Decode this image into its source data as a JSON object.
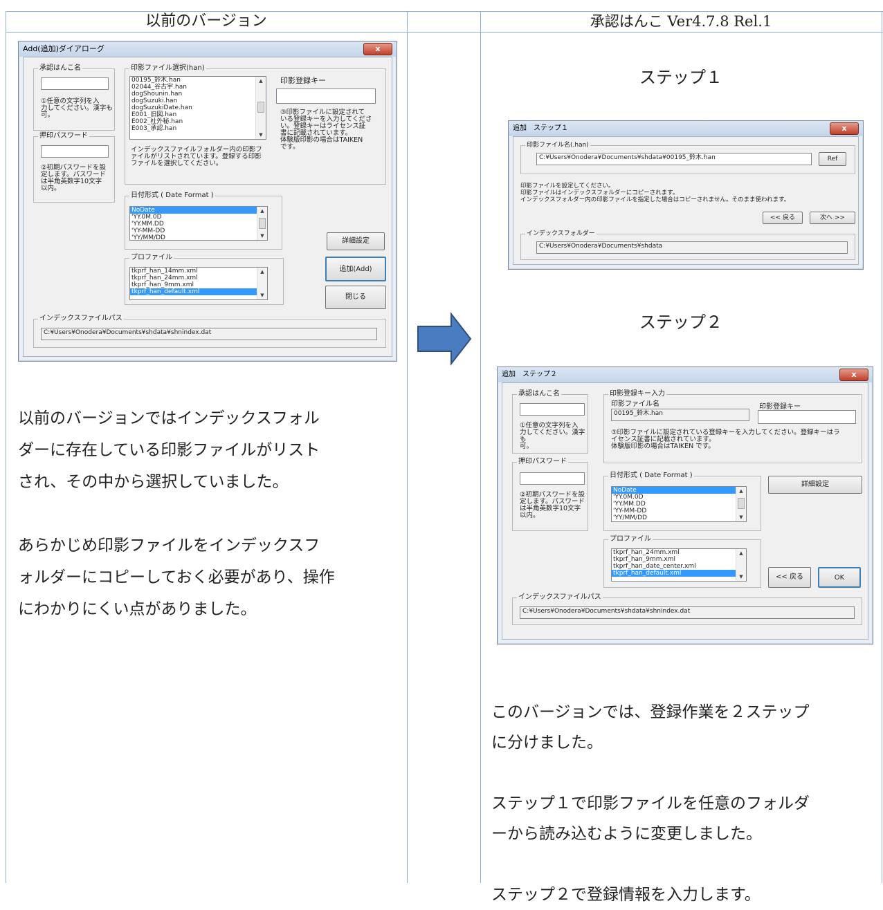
{
  "headers": {
    "left": "以前のバージョン",
    "right": "承認はんこ Ver4.7.8 Rel.1"
  },
  "old_dialog": {
    "title": "Add(追加)ダイアローグ",
    "close": "x",
    "hanko_group": "承認はんこ名",
    "hanko_value": "",
    "hanko_note": "①任意の文字列を入\n力してください。漢字も\n可。",
    "pw_group": "押印パスワード",
    "pw_value": "",
    "pw_note": "②初期パスワードを設\n定します。パスワード\nは半角英数字10文字\n以内。",
    "file_group": "印影ファイル選択(han)",
    "files": [
      "00195_鈴木.han",
      "02044_谷古宇.han",
      "dogShounin.han",
      "dogSuzuki.han",
      "dogSuzukiDate.han",
      "E001_旧図.han",
      "E002_社外秘.han",
      "E003_承認.han"
    ],
    "file_note": "インデックスファイルフォルダー内の印影フ\nァイルがリストされています。登録する印影\nファイルを選択してください。",
    "key_label": "印影登録キー",
    "key_value": "",
    "key_note": "③印影ファイルに設定されて\nいる登録キーを入力してくださ\nい。登録キーはライセンス証\n書に記載されています。\n体験版印影の場合はTAIKEN\nです。",
    "date_group": "日付形式 ( Date Format )",
    "dates": [
      "NoDate",
      "'YY.0M.0D",
      "'YY.MM.DD",
      "'YY-MM-DD",
      "'YY/MM/DD"
    ],
    "profile_group": "プロファイル",
    "profiles": [
      "tkprf_han_14mm.xml",
      "tkprf_han_24mm.xml",
      "tkprf_han_9mm.xml",
      "tkprf_han_default.xml"
    ],
    "detail_btn": "詳細設定",
    "add_btn": "追加(Add)",
    "close_btn": "閉じる",
    "index_group": "インデックスファイルパス",
    "index_path": "C:¥Users¥Onodera¥Documents¥shdata¥shnindex.dat"
  },
  "left_text": [
    "以前のバージョンではインデックスフォル",
    "ダーに存在している印影ファイルがリスト",
    "され、その中から選択していました。",
    "",
    "あらかじめ印影ファイルをインデックスフ",
    "ォルダーにコピーしておく必要があり、操作",
    "にわかりにくい点がありました。"
  ],
  "step1": {
    "heading": "ステップ１",
    "title": "追加　ステップ１",
    "close": "x",
    "file_group": "印影ファイル名(.han)",
    "file_path": "C:¥Users¥Onodera¥Documents¥shdata¥00195_鈴木.han",
    "ref_btn": "Ref",
    "note": "印影ファイルを設定してください。\n印影ファイルはインデックスフォルダーにコピーされます。\nインデックスフォルダー内の印影ファイルを指定した場合はコピーされません。そのまま使われます。",
    "back_btn": "<< 戻る",
    "next_btn": "次へ >>",
    "index_group": "インデックスフォルダー",
    "index_path": "C:¥Users¥Onodera¥Documents¥shdata"
  },
  "step2": {
    "heading": "ステップ２",
    "title": "追加　ステップ２",
    "close": "x",
    "hanko_group": "承認はんこ名",
    "hanko_value": "",
    "hanko_note": "①任意の文字列を入\n力してください。漢字も\n可。",
    "pw_group": "押印パスワード",
    "pw_value": "",
    "pw_note": "②初期パスワードを設\n定します。パスワード\nは半角英数字10文字\n以内。",
    "key_group": "印影登録キー入力",
    "file_label": "印影ファイル名",
    "file_value": "00195_鈴木.han",
    "key_label": "印影登録キー",
    "key_value": "",
    "key_note": "③印影ファイルに設定されている登録キーを入力してください。登録キーはラ\nイセンス証書に記載されています。\n体験版印影の場合はTAIKEN です。",
    "date_group": "日付形式 ( Date Format )",
    "dates": [
      "NoDate",
      "'YY.0M.0D",
      "'YY.MM.DD",
      "'YY-MM-DD",
      "'YY/MM/DD"
    ],
    "detail_btn": "詳細設定",
    "profile_group": "プロファイル",
    "profiles": [
      "tkprf_han_24mm.xml",
      "tkprf_han_9mm.xml",
      "tkprf_han_date_center.xml",
      "tkprf_han_default.xml"
    ],
    "back_btn": "<< 戻る",
    "ok_btn": "OK",
    "index_group": "インデックスファイルパス",
    "index_path": "C:¥Users¥Onodera¥Documents¥shdata¥shnindex.dat"
  },
  "right_text": [
    "このバージョンでは、登録作業を２ステップ",
    "に分けました。",
    "",
    "ステップ１で印影ファイルを任意のフォルダ",
    "ーから読み込むように変更しました。",
    "",
    "ステップ２で登録情報を入力します。"
  ]
}
